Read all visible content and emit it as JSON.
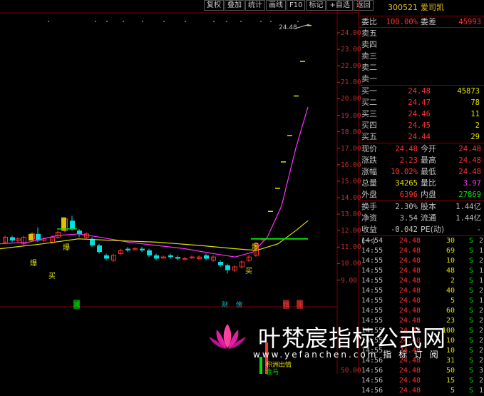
{
  "toolbar": [
    "复权",
    "叠加",
    "统计",
    "画线",
    "F10",
    "标记",
    "+自选",
    "返回"
  ],
  "price_axis": [
    "24.00",
    "23.00",
    "22.00",
    "21.00",
    "20.00",
    "19.00",
    "18.00",
    "17.00",
    "16.00",
    "15.00",
    "14.00",
    "13.00",
    "12.00",
    "11.00",
    "10.00",
    "9.00",
    "50.00"
  ],
  "chart_labels": {
    "top_price": "24.48",
    "bao1": "爆",
    "bao2": "爆",
    "bao3": "爆",
    "buy1": "买",
    "buy2": "买",
    "cai": "财",
    "fu": "傍",
    "jian": "减",
    "zeng": "精",
    "zhang": "涨",
    "jibang": "积洲出情",
    "jinma": "金马"
  },
  "stock": {
    "code": "300521",
    "name": "爱司凯"
  },
  "weibi": {
    "l1": "委比",
    "v1": "100.00%",
    "l2": "委差",
    "v2": "45993"
  },
  "sells": [
    {
      "label": "卖五"
    },
    {
      "label": "卖四"
    },
    {
      "label": "卖三"
    },
    {
      "label": "卖二"
    },
    {
      "label": "卖一"
    }
  ],
  "buys": [
    {
      "label": "买一",
      "price": "24.48",
      "vol": "45873"
    },
    {
      "label": "买二",
      "price": "24.47",
      "vol": "78"
    },
    {
      "label": "买三",
      "price": "24.46",
      "vol": "11"
    },
    {
      "label": "买四",
      "price": "24.45",
      "vol": "2"
    },
    {
      "label": "买五",
      "price": "24.44",
      "vol": "29"
    }
  ],
  "stats": [
    {
      "l1": "现价",
      "v1": "24.48",
      "l2": "今开",
      "v2": "24.48",
      "c1": "#ff3030",
      "c2": "#ff3030"
    },
    {
      "l1": "涨跌",
      "v1": "2.23",
      "l2": "最高",
      "v2": "24.48",
      "c1": "#ff3030",
      "c2": "#ff3030"
    },
    {
      "l1": "涨幅",
      "v1": "10.02%",
      "l2": "最低",
      "v2": "24.48",
      "c1": "#ff3030",
      "c2": "#ff3030"
    },
    {
      "l1": "总量",
      "v1": "34265",
      "l2": "量比",
      "v2": "3.97",
      "c1": "#e0e000",
      "c2": "#ff30ff"
    },
    {
      "l1": "外盘",
      "v1": "6396",
      "l2": "内盘",
      "v2": "27869",
      "c1": "#ff3030",
      "c2": "#00e000"
    }
  ],
  "stats2": [
    {
      "l1": "换手",
      "v1": "2.30%",
      "l2": "股本",
      "v2": "1.44亿",
      "c1": "#c0c0c0",
      "c2": "#c0c0c0"
    },
    {
      "l1": "净资",
      "v1": "3.54",
      "l2": "流通",
      "v2": "1.44亿",
      "c1": "#c0c0c0",
      "c2": "#c0c0c0"
    },
    {
      "l1": "收益(一)",
      "v1": "-0.042",
      "l2": "PE(动)",
      "v2": "-",
      "c1": "#c0c0c0",
      "c2": "#c0c0c0"
    }
  ],
  "ticks": [
    {
      "t": "14:54",
      "p": "24.48",
      "q": "30",
      "s": "S",
      "c": "2"
    },
    {
      "t": "14:55",
      "p": "24.48",
      "q": "69",
      "s": "S",
      "c": "1"
    },
    {
      "t": "14:55",
      "p": "24.48",
      "q": "10",
      "s": "S",
      "c": "2"
    },
    {
      "t": "14:55",
      "p": "24.48",
      "q": "48",
      "s": "S",
      "c": "1"
    },
    {
      "t": "14:55",
      "p": "24.48",
      "q": "2",
      "s": "S",
      "c": "1"
    },
    {
      "t": "14:55",
      "p": "24.48",
      "q": "40",
      "s": "S",
      "c": "2"
    },
    {
      "t": "14:55",
      "p": "24.48",
      "q": "5",
      "s": "S",
      "c": "1"
    },
    {
      "t": "14:55",
      "p": "24.48",
      "q": "60",
      "s": "S",
      "c": "2"
    },
    {
      "t": "14:55",
      "p": "24.48",
      "q": "23",
      "s": "S",
      "c": "2"
    },
    {
      "t": "14:55",
      "p": "24.48",
      "q": "100",
      "s": "S",
      "c": "2"
    },
    {
      "t": "14:55",
      "p": "24.48",
      "q": "10",
      "s": "S",
      "c": "2"
    },
    {
      "t": "14:55",
      "p": "24.48",
      "q": "10",
      "s": "S",
      "c": "2"
    },
    {
      "t": "14:56",
      "p": "24.48",
      "q": "31",
      "s": "S",
      "c": "2"
    },
    {
      "t": "14:56",
      "p": "24.48",
      "q": "50",
      "s": "S",
      "c": "3"
    },
    {
      "t": "14:56",
      "p": "24.48",
      "q": "15",
      "s": "S",
      "c": "2"
    },
    {
      "t": "14:56",
      "p": "24.48",
      "q": "5",
      "s": "S",
      "c": "1"
    }
  ],
  "watermark": {
    "text": "叶梵宸指标公式网",
    "url": "www.yefanchen.com 指 标 订 阅"
  },
  "colors": {
    "up": "#ff3030",
    "down": "#00e0e0",
    "ma5": "#ff30ff",
    "ma10": "#e0e000",
    "border": "#800000"
  }
}
